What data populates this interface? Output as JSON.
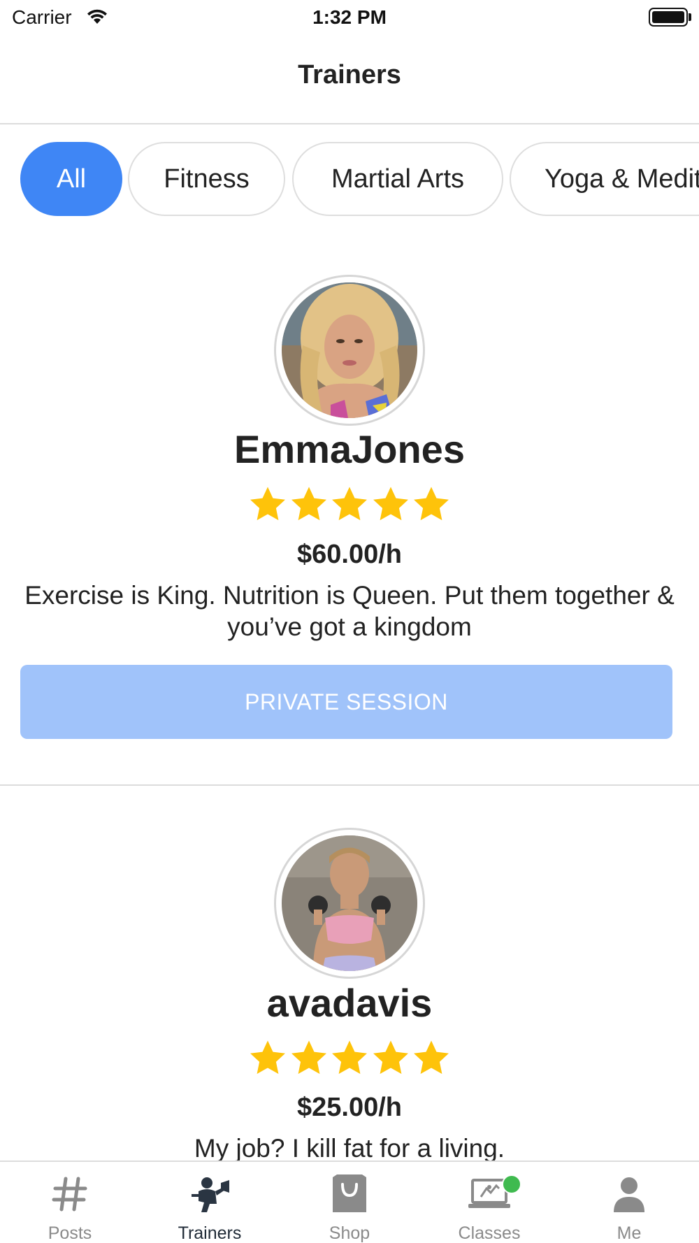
{
  "status_bar": {
    "carrier": "Carrier",
    "time": "1:32 PM"
  },
  "nav": {
    "title": "Trainers"
  },
  "filters": [
    {
      "label": "All",
      "active": true
    },
    {
      "label": "Fitness",
      "active": false
    },
    {
      "label": "Martial Arts",
      "active": false
    },
    {
      "label": "Yoga & Medit",
      "active": false
    }
  ],
  "trainers": [
    {
      "name": "EmmaJones",
      "rating": 5,
      "price": "$60.00/h",
      "bio": "Exercise is King. Nutrition is Queen. Put them together & you’ve got a kingdom",
      "button_label": "PRIVATE SESSION"
    },
    {
      "name": "avadavis",
      "rating": 5,
      "price": "$25.00/h",
      "bio": "My job? I kill fat for a living."
    }
  ],
  "tabs": [
    {
      "label": "Posts",
      "icon": "hashtag-icon",
      "active": false
    },
    {
      "label": "Trainers",
      "icon": "trainer-icon",
      "active": true
    },
    {
      "label": "Shop",
      "icon": "shopping-bag-icon",
      "active": false
    },
    {
      "label": "Classes",
      "icon": "laptop-class-icon",
      "active": false,
      "badge": true
    },
    {
      "label": "Me",
      "icon": "person-icon",
      "active": false
    }
  ],
  "colors": {
    "accent": "#3f86f5",
    "button_disabled": "#a0c3fa",
    "star": "#fec30a",
    "badge": "#3fba4f"
  }
}
